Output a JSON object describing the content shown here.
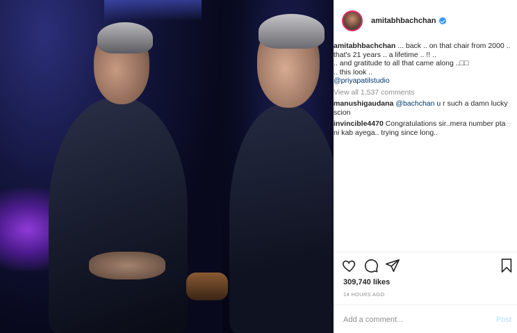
{
  "post": {
    "username": "amitabhbachchan",
    "caption_lines": [
      "... back .. on that chair from 2000 ..",
      "that's 21 years .. a lifetime .. !! ..",
      ".. and gratitude to all that came along ..□□",
      ".. this look .."
    ],
    "caption_mention": "@priyapatilstudio",
    "view_all": "View all 1,537 comments",
    "comments": [
      {
        "user": "manushigaudana",
        "mention": "@bachchan",
        "text": " u r such a damn lucky scion"
      },
      {
        "user": "invincible4470",
        "mention": "",
        "text": " Congratulations sir..mera number pta ni kab ayega.. trying since long.."
      }
    ],
    "likes": "309,740 likes",
    "timestamp": "14 HOURS AGO",
    "comment_placeholder": "Add a comment...",
    "post_label": "Post"
  },
  "colors": {
    "link": "#00376b",
    "muted": "#8e8e8e",
    "verified": "#3897f0",
    "post_disabled": "#b2dffc"
  },
  "icons": [
    "like-heart-icon",
    "comment-icon",
    "share-icon",
    "bookmark-icon",
    "verified-badge-icon"
  ]
}
